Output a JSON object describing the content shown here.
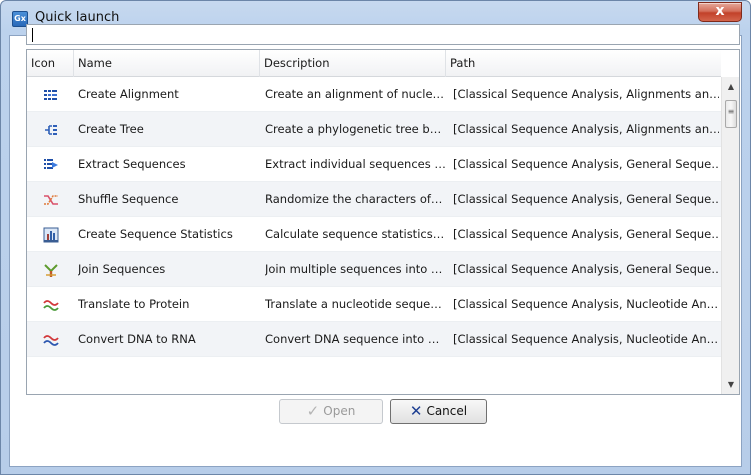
{
  "window": {
    "title": "Quick launch",
    "app_badge": "Gx",
    "close_glyph": "x"
  },
  "search": {
    "value": "",
    "placeholder": ""
  },
  "table": {
    "headers": {
      "icon": "Icon",
      "name": "Name",
      "description": "Description",
      "path": "Path"
    },
    "rows": [
      {
        "icon": "alignment-icon",
        "name": "Create Alignment",
        "description": "Create an alignment of nucle…",
        "path": "[Classical Sequence Analysis, Alignments an…"
      },
      {
        "icon": "tree-icon",
        "name": "Create Tree",
        "description": "Create a phylogenetic tree b…",
        "path": "[Classical Sequence Analysis, Alignments an…"
      },
      {
        "icon": "extract-sequences-icon",
        "name": "Extract Sequences",
        "description": "Extract individual sequences …",
        "path": "[Classical Sequence Analysis, General Seque…"
      },
      {
        "icon": "shuffle-icon",
        "name": "Shuffle Sequence",
        "description": "Randomize the characters of…",
        "path": "[Classical Sequence Analysis, General Seque…"
      },
      {
        "icon": "statistics-icon",
        "name": "Create Sequence Statistics",
        "description": "Calculate sequence statistics…",
        "path": "[Classical Sequence Analysis, General Seque…"
      },
      {
        "icon": "join-sequences-icon",
        "name": "Join Sequences",
        "description": "Join multiple sequences into …",
        "path": "[Classical Sequence Analysis, General Seque…"
      },
      {
        "icon": "translate-icon",
        "name": "Translate to Protein",
        "description": "Translate a nucleotide seque…",
        "path": "[Classical Sequence Analysis, Nucleotide An…"
      },
      {
        "icon": "dna-to-rna-icon",
        "name": "Convert DNA to RNA",
        "description": "Convert DNA sequence into …",
        "path": "[Classical Sequence Analysis, Nucleotide An…"
      }
    ]
  },
  "buttons": {
    "open": {
      "label": "Open",
      "icon": "checkmark-icon",
      "enabled": false
    },
    "cancel": {
      "label": "Cancel",
      "icon": "cross-icon",
      "enabled": true
    }
  },
  "colors": {
    "titlebar": "#bcd2ed",
    "close": "#c2412a",
    "row_alt": "#f2f4f7",
    "cancel_glyph": "#1e3f92"
  }
}
